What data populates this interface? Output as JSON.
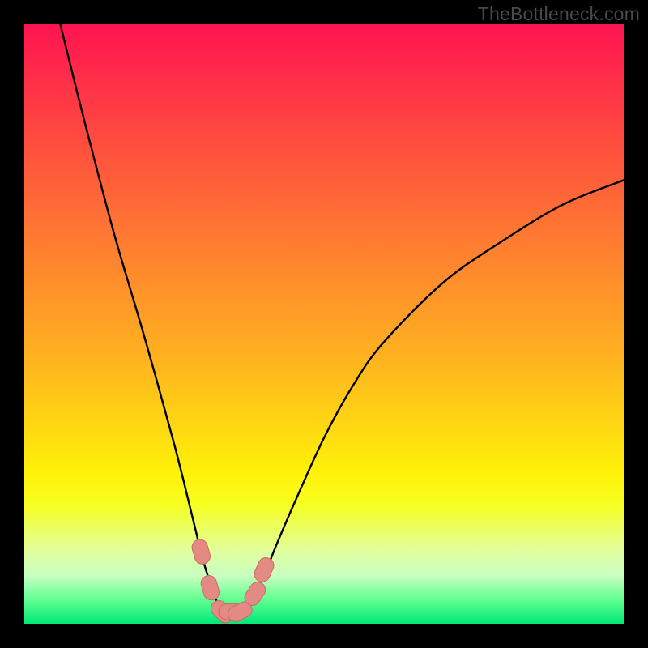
{
  "watermark": "TheBottleneck.com",
  "chart_data": {
    "type": "line",
    "title": "",
    "xlabel": "",
    "ylabel": "",
    "xlim": [
      0,
      100
    ],
    "ylim": [
      0,
      100
    ],
    "grid": false,
    "legend": false,
    "series": [
      {
        "name": "bottleneck-curve",
        "x": [
          6,
          10,
          15,
          20,
          25,
          28,
          30,
          32,
          33,
          34,
          36,
          38,
          40,
          42,
          45,
          50,
          55,
          60,
          70,
          80,
          90,
          100
        ],
        "y": [
          100,
          84,
          65,
          48,
          30,
          18,
          10,
          4,
          2,
          2,
          2,
          4,
          8,
          13,
          20,
          31,
          40,
          47,
          57,
          64,
          70,
          74
        ]
      }
    ],
    "markers": [
      {
        "name": "left-marker-upper",
        "x": 29.5,
        "y": 12
      },
      {
        "name": "left-marker-lower",
        "x": 31,
        "y": 6
      },
      {
        "name": "bottom-marker-1",
        "x": 33,
        "y": 2
      },
      {
        "name": "bottom-marker-2",
        "x": 34.5,
        "y": 2
      },
      {
        "name": "bottom-marker-3",
        "x": 36,
        "y": 2
      },
      {
        "name": "right-marker-lower",
        "x": 38.5,
        "y": 5
      },
      {
        "name": "right-marker-upper",
        "x": 40,
        "y": 9
      }
    ],
    "marker_style": {
      "fill": "#e48a84",
      "stroke": "#c96a64",
      "radius_pct": 1.3
    },
    "gradient_stops": [
      {
        "pct": 0,
        "color": "#ff1450"
      },
      {
        "pct": 50,
        "color": "#ffb020"
      },
      {
        "pct": 80,
        "color": "#f8ff20"
      },
      {
        "pct": 100,
        "color": "#00e878"
      }
    ]
  }
}
